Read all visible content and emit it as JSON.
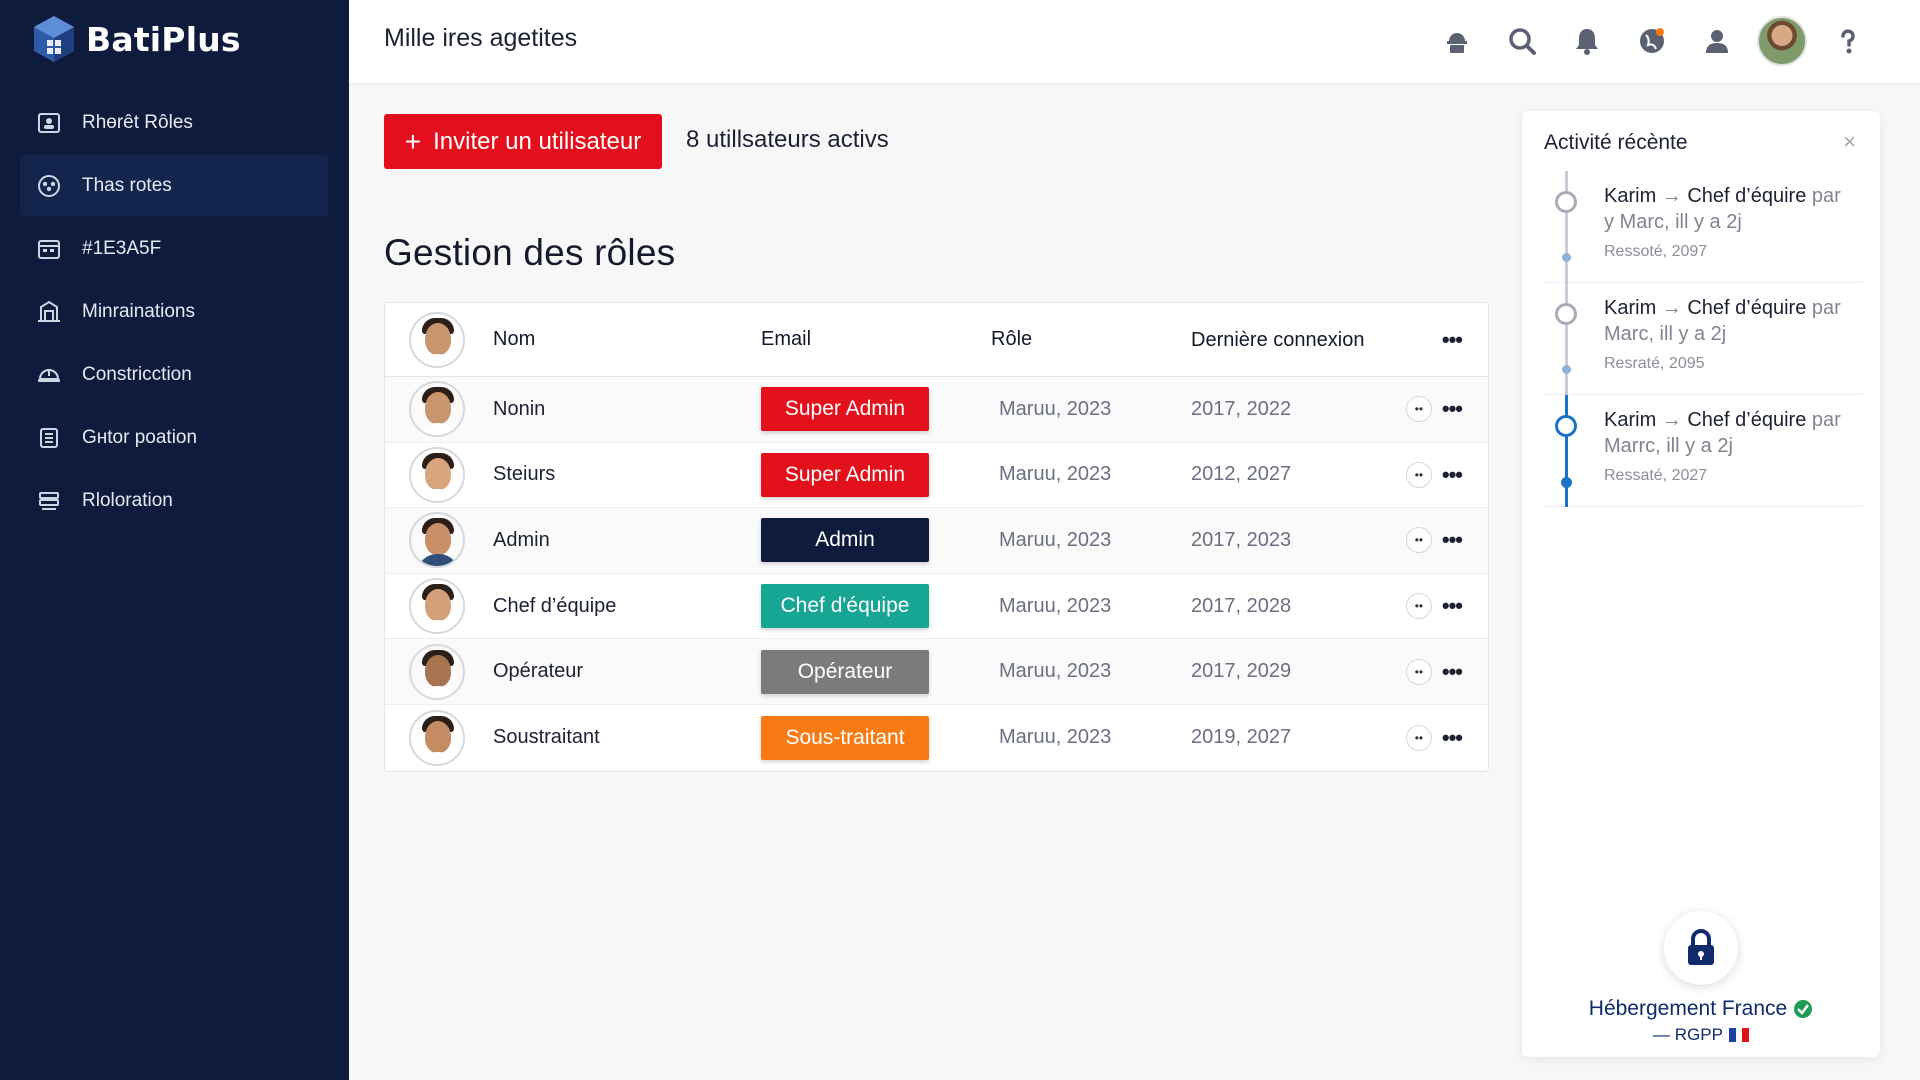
{
  "brand": {
    "name": "BatiPlus"
  },
  "sidebar": {
    "items": [
      {
        "label": "Rhөrêt Rôles",
        "icon": "badge-icon",
        "active": false
      },
      {
        "label": "Thas rotes",
        "icon": "group-icon",
        "active": true
      },
      {
        "label": "#1E3A5F",
        "icon": "calendar-icon",
        "active": false
      },
      {
        "label": "Minrainations",
        "icon": "crane-icon",
        "active": false
      },
      {
        "label": "Constricction",
        "icon": "helmet-icon",
        "active": false
      },
      {
        "label": "Gнtor poation",
        "icon": "building-icon",
        "active": false
      },
      {
        "label": "Rloloration",
        "icon": "layers-icon",
        "active": false
      }
    ]
  },
  "header": {
    "title": "Mille ires agetites",
    "icons": [
      "construction-icon",
      "search-icon",
      "bell-icon",
      "globe-icon",
      "user-icon",
      "avatar",
      "help-icon"
    ]
  },
  "actions": {
    "invite_label": "Inviter un utilisateur",
    "active_count": "8 utillsateurs activs"
  },
  "page_title": "Gestion des rôles",
  "table": {
    "headers": {
      "name": "Nom",
      "email": "Email",
      "role": "Rôle",
      "last_login": "Dernière connexion"
    },
    "rows": [
      {
        "name": "Nonin",
        "badge": "Super Admin",
        "badge_color": "#E3111C",
        "role": "Maruu, 2023",
        "last": "2017, 2022",
        "skin": "#c8956d",
        "shirt": "#ffffff"
      },
      {
        "name": "Steiurs",
        "badge": "Super Admin",
        "badge_color": "#E3111C",
        "role": "Maruu, 2023",
        "last": "2012, 2027",
        "skin": "#d9a57c",
        "shirt": "#ffffff"
      },
      {
        "name": "Admin",
        "badge": "Admin",
        "badge_color": "#0F1B3D",
        "role": "Maruu, 2023",
        "last": "2017, 2023",
        "skin": "#c98f66",
        "shirt": "#2f4f7a"
      },
      {
        "name": "Chef d’équipe",
        "badge": "Chef d'équipe",
        "badge_color": "#17A594",
        "role": "Maruu, 2023",
        "last": "2017, 2028",
        "skin": "#d4a07a",
        "shirt": "#ffffff"
      },
      {
        "name": "Opérateur",
        "badge": "Opérateur",
        "badge_color": "#7B7B7B",
        "role": "Maruu, 2023",
        "last": "2017, 2029",
        "skin": "#a8734f",
        "shirt": "#ffffff"
      },
      {
        "name": "Soustraitant",
        "badge": "Sous-traitant",
        "badge_color": "#F77B14",
        "role": "Maruu, 2023",
        "last": "2019, 2027",
        "skin": "#c48c63",
        "shirt": "#ffffff"
      }
    ]
  },
  "activity": {
    "title": "Activité récènte",
    "items": [
      {
        "who": "Karim",
        "arrow": "→",
        "what": "Chef d’équire",
        "par": "par",
        "line2": "y Marc, ill y a 2j",
        "sub": "Ressoté, 2097",
        "active": false
      },
      {
        "who": "Karim",
        "arrow": "→",
        "what": "Chef d’équire",
        "par": "par",
        "line2": "Marc, ill y a 2j",
        "sub": "Resraté, 2095",
        "active": false
      },
      {
        "who": "Karim",
        "arrow": "→",
        "what": "Chef d’équire",
        "par": "par",
        "line2": "Marrc, ill y a 2j",
        "sub": "Ressaté, 2027",
        "active": true
      }
    ]
  },
  "hosting": {
    "title": "Hébergement France",
    "subtitle": "— RGPP",
    "color": "#102A6B"
  }
}
